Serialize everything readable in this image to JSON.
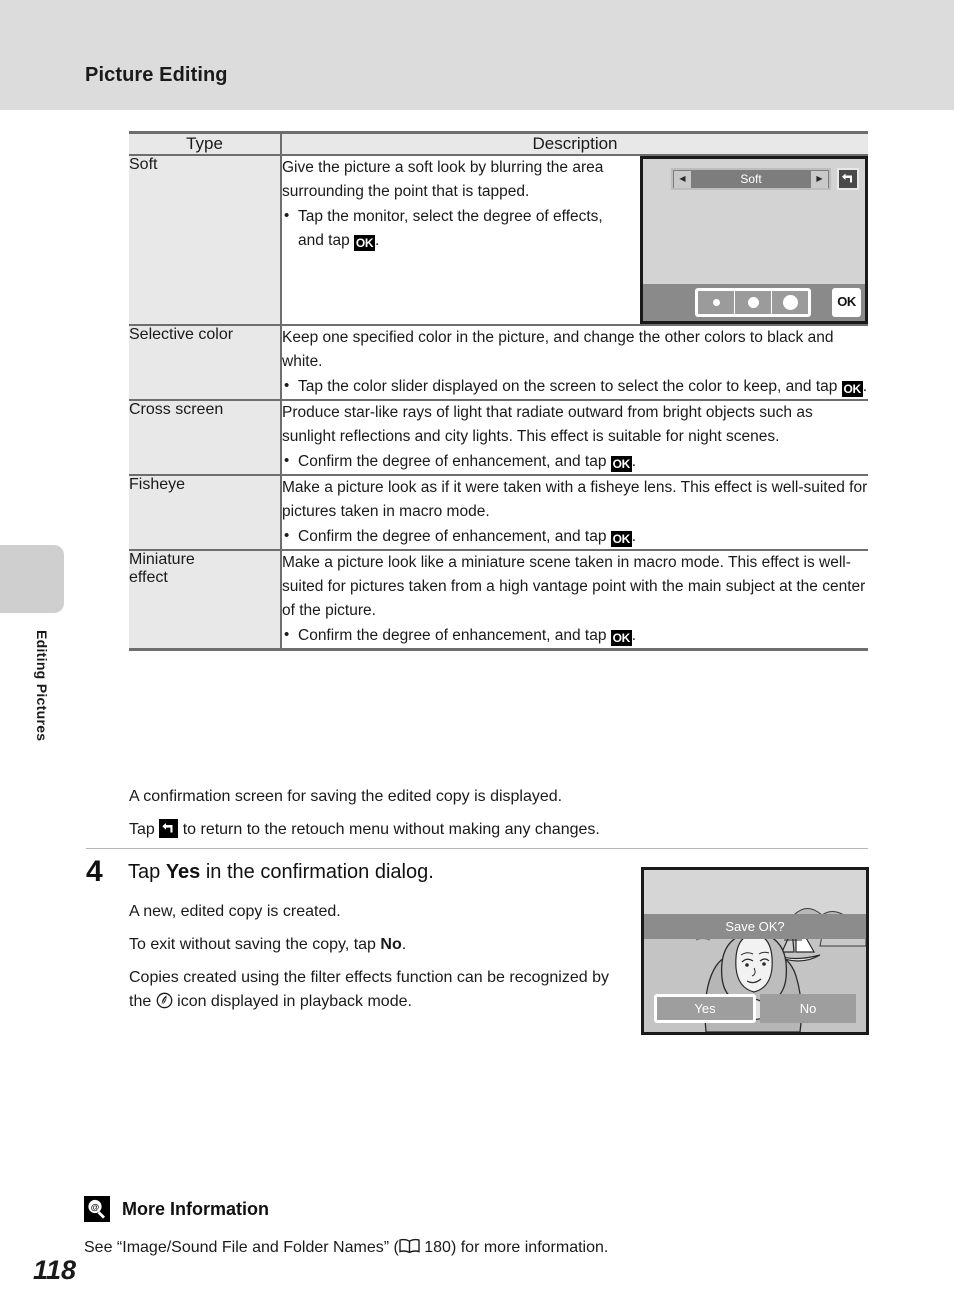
{
  "header": {
    "title": "Picture Editing"
  },
  "sidebar": {
    "vertical_label": "Editing Pictures"
  },
  "page": {
    "number": "118"
  },
  "table": {
    "columns": [
      "Type",
      "Description"
    ],
    "rows": [
      {
        "type": "Soft",
        "lines": [
          "Give the picture a soft look by blurring the area surrounding the point that is tapped."
        ],
        "bullets": [
          {
            "pre": "Tap the monitor, select the degree of effects, and tap ",
            "icon": "ok-icon",
            "post": "."
          }
        ],
        "screenshot": {
          "title": "Soft",
          "left_arrow": "◀",
          "right_arrow": "▶",
          "return_icon": "back-arrow-icon",
          "ok_label": "OK",
          "dots": [
            "small",
            "medium",
            "large"
          ]
        }
      },
      {
        "type": "Selective color",
        "lines": [
          "Keep one specified color in the picture, and change the other colors to black and white."
        ],
        "bullets": [
          {
            "pre": "Tap the color slider displayed on the screen to select the color to keep, and tap ",
            "icon": "ok-icon",
            "post": "."
          }
        ]
      },
      {
        "type": "Cross screen",
        "lines": [
          "Produce star-like rays of light that radiate outward from bright objects such as sunlight reflections and city lights. This effect is suitable for night scenes."
        ],
        "bullets": [
          {
            "pre": "Confirm the degree of enhancement, and tap ",
            "icon": "ok-icon",
            "post": "."
          }
        ]
      },
      {
        "type": "Fisheye",
        "lines": [
          "Make a picture look as if it were taken with a fisheye lens. This effect is well-suited for pictures taken in macro mode."
        ],
        "bullets": [
          {
            "pre": "Confirm the degree of enhancement, and tap ",
            "icon": "ok-icon",
            "post": "."
          }
        ]
      },
      {
        "type": "Miniature effect",
        "type_line1": "Miniature",
        "type_line2": "effect",
        "lines": [
          "Make a picture look like a miniature scene taken in macro mode. This effect is well-suited for pictures taken from a high vantage point with the main subject at the center of the picture."
        ],
        "bullets": [
          {
            "pre": "Confirm the degree of enhancement, and tap ",
            "icon": "ok-icon",
            "post": "."
          }
        ]
      }
    ]
  },
  "after_table": {
    "line1": "A confirmation screen for saving the edited copy is displayed.",
    "line2_pre": "Tap ",
    "line2_icon": "back-arrow-icon",
    "line2_post": " to return to the retouch menu without making any changes."
  },
  "step": {
    "number": "4",
    "title_pre": "Tap ",
    "title_bold": "Yes",
    "title_post": " in the confirmation dialog.",
    "body_line1": "A new, edited copy is created.",
    "body_line2_pre": "To exit without saving the copy, tap ",
    "body_line2_bold": "No",
    "body_line2_post": ".",
    "body_line3_pre": "Copies created using the filter effects function can be recognized by the ",
    "body_line3_icon": "filter-effects-icon",
    "body_line3_post": " icon displayed in playback mode."
  },
  "save_dialog": {
    "message": "Save OK?",
    "yes_label": "Yes",
    "no_label": "No"
  },
  "more_info": {
    "icon": "more-information-icon",
    "heading": "More Information",
    "body_pre": "See “Image/Sound File and Folder Names” (",
    "body_icon": "book-icon",
    "body_page": " 180",
    "body_post": ") for more information."
  },
  "colors": {
    "header_band": "#dcdcdc",
    "table_header_fill": "#e8e8e8",
    "table_border": "#6e6e6e",
    "camera_body": "#d3d3d3"
  }
}
